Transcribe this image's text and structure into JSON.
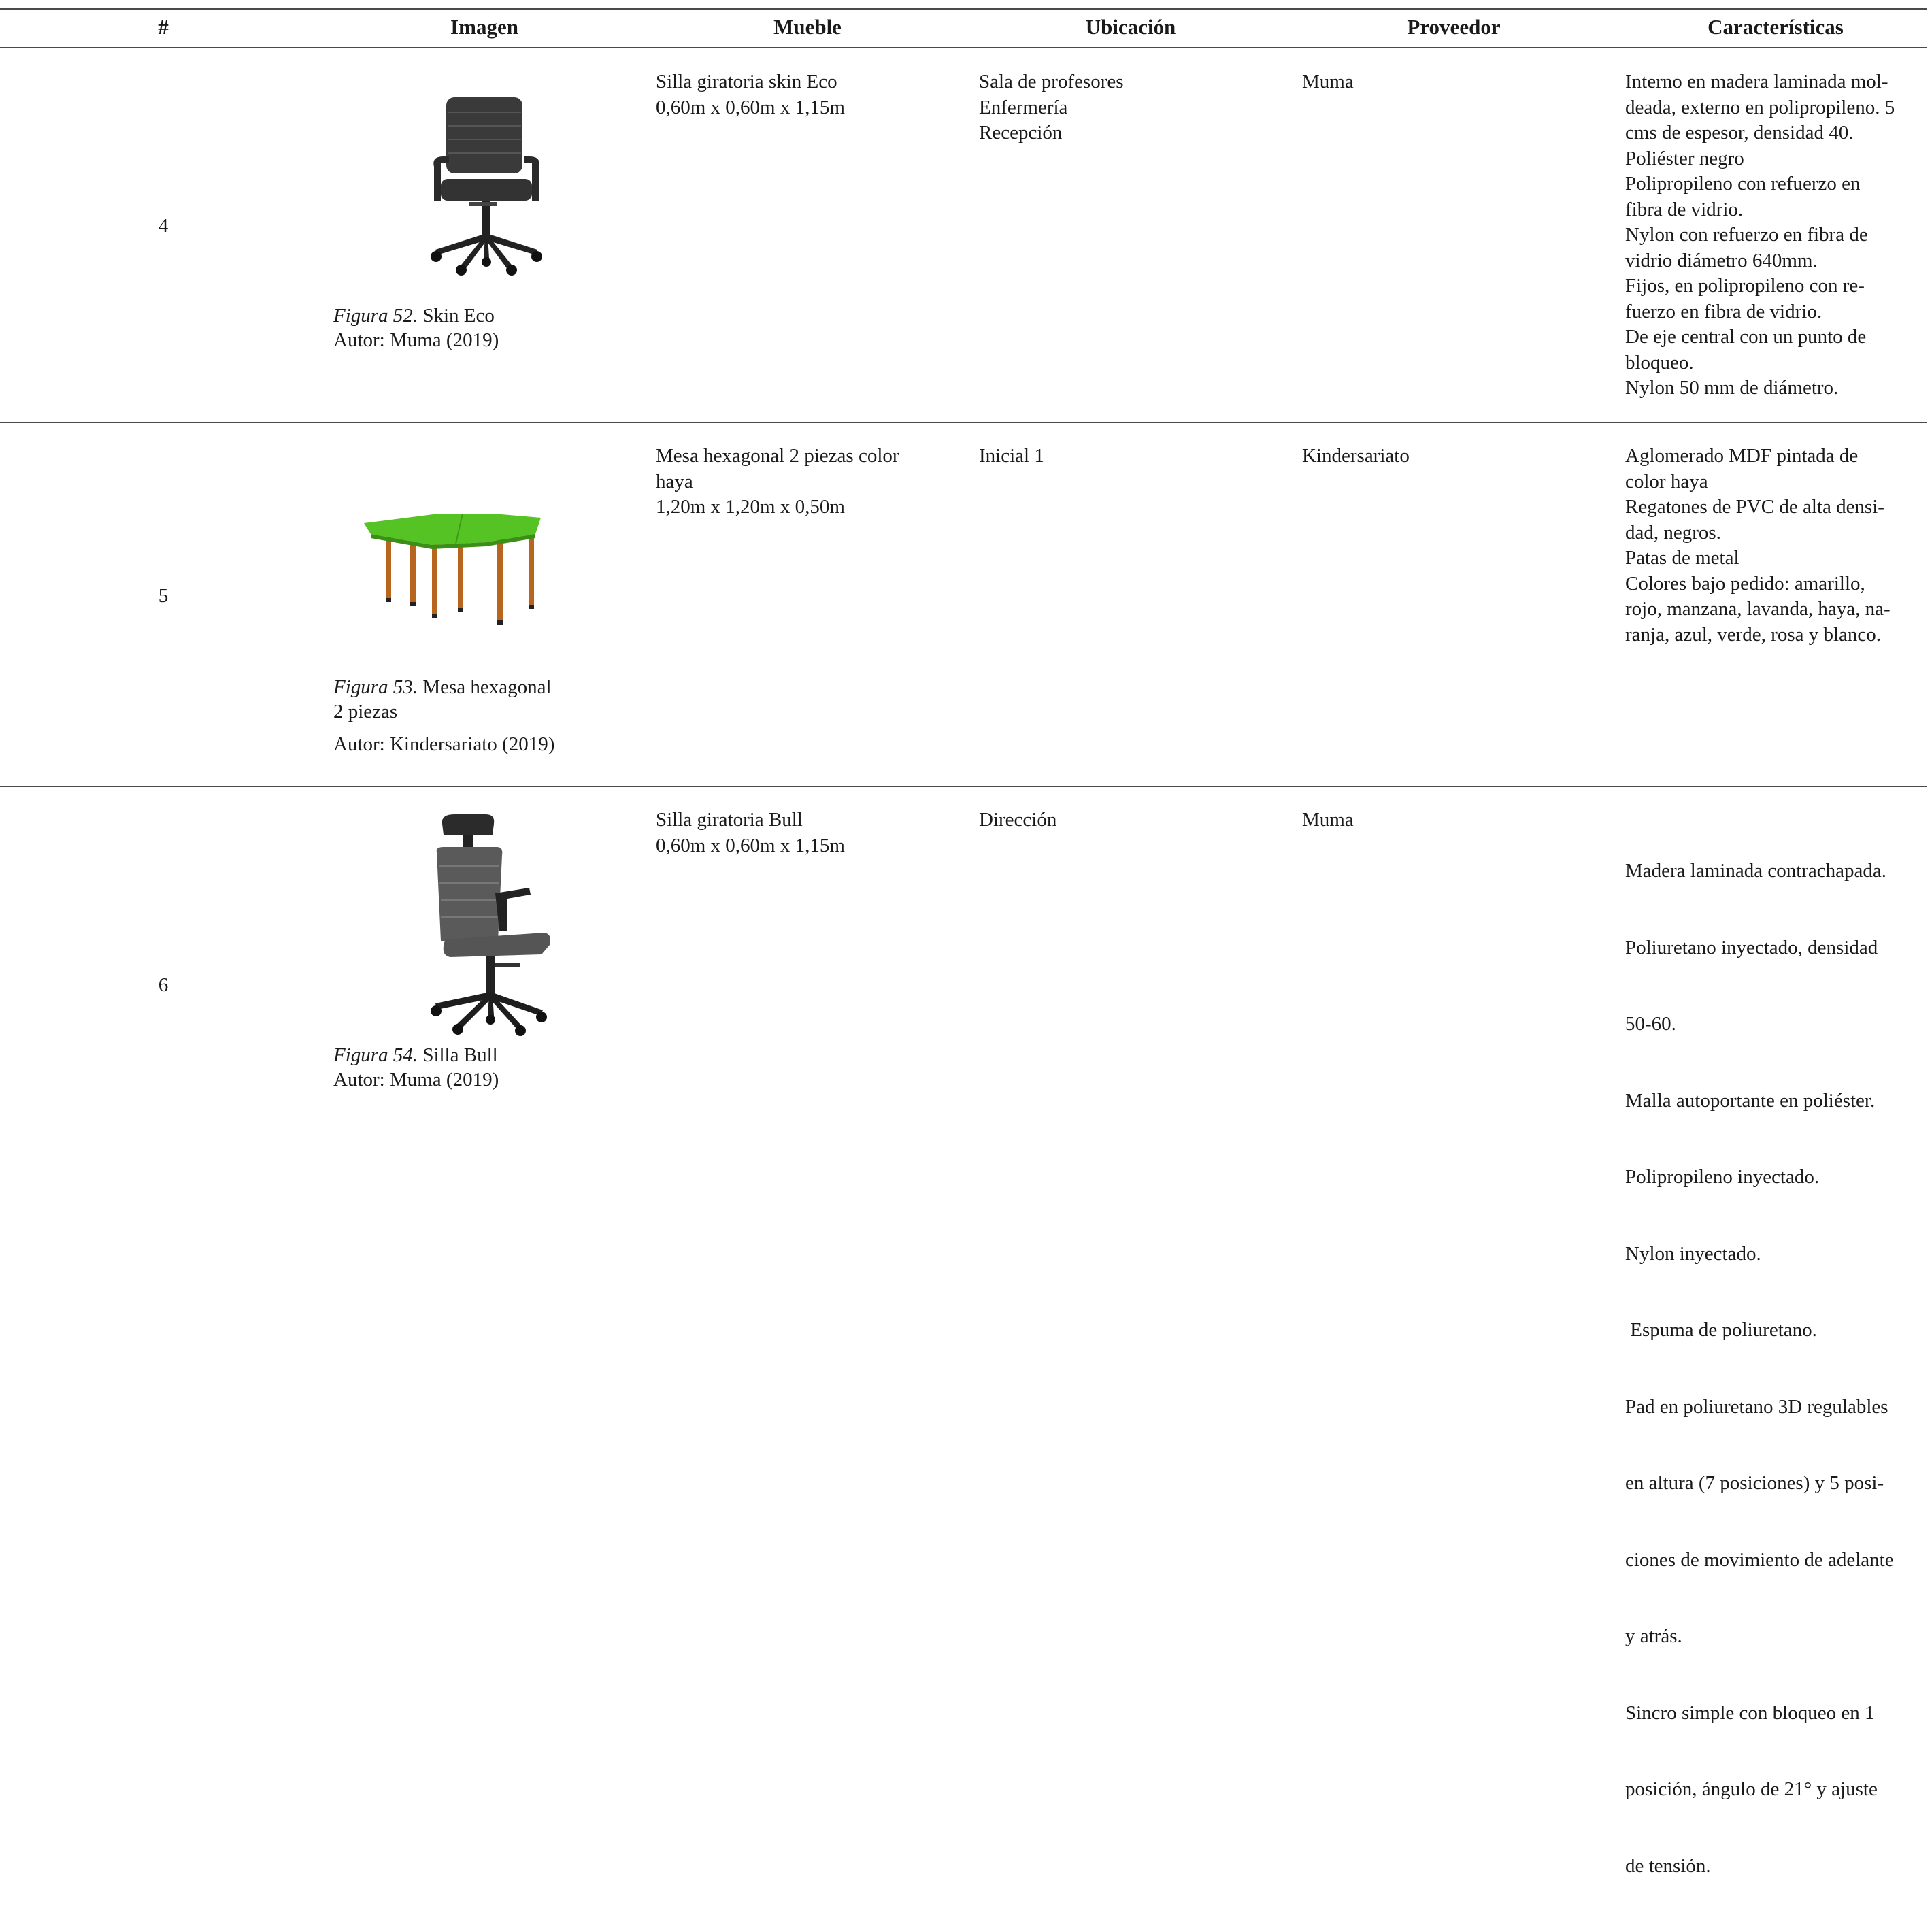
{
  "headers": [
    "#",
    "Imagen",
    "Mueble",
    "Ubicación",
    "Proveedor",
    "Características"
  ],
  "rows": [
    {
      "num": "4",
      "fig_label": "Figura 52.",
      "fig_title": "Skin Eco",
      "fig_title_2": "",
      "author": "Autor: Muma (2019)",
      "image_icon": "office-chair-mesh",
      "mueble": [
        "Silla giratoria skin Eco",
        "0,60m x 0,60m x 1,15m"
      ],
      "ubicacion": [
        "Sala de profesores",
        "Enfermería",
        "Recepción"
      ],
      "proveedor": "Muma",
      "caracteristicas": [
        "Interno en madera laminada mol-",
        "deada, externo en polipropileno. 5",
        "cms de espesor, densidad 40.",
        "Poliéster negro",
        "Polipropileno con refuerzo en",
        "fibra de vidrio.",
        "Nylon con refuerzo en fibra de",
        "vidrio diámetro 640mm.",
        "Fijos, en polipropileno con re-",
        "fuerzo en fibra de vidrio.",
        "De eje central con un punto de",
        "bloqueo.",
        "Nylon 50 mm de diámetro."
      ]
    },
    {
      "num": "5",
      "fig_label": "Figura 53.",
      "fig_title": "Mesa hexagonal",
      "fig_title_2": "2 piezas",
      "author": "Autor: Kindersariato (2019)",
      "image_icon": "hexagonal-table-green",
      "mueble": [
        "Mesa hexagonal 2 piezas color",
        "haya",
        "1,20m x 1,20m x 0,50m"
      ],
      "ubicacion": [
        "Inicial 1"
      ],
      "proveedor": "Kindersariato",
      "caracteristicas": [
        "Aglomerado MDF pintada de",
        "color haya",
        "Regatones de PVC de alta densi-",
        "dad, negros.",
        "Patas de metal",
        "Colores bajo pedido: amarillo,",
        "rojo, manzana, lavanda, haya, na-",
        "ranja, azul, verde, rosa y blanco."
      ]
    },
    {
      "num": "6",
      "fig_label": "Figura 54.",
      "fig_title": "Silla Bull",
      "fig_title_2": "",
      "author": "Autor: Muma (2019)",
      "image_icon": "office-chair-headrest",
      "mueble": [
        "Silla giratoria Bull",
        "0,60m x 0,60m x 1,15m"
      ],
      "ubicacion": [
        "Dirección"
      ],
      "proveedor": "Muma",
      "caracteristicas": [
        "Madera laminada contrachapada.",
        "Poliuretano inyectado, densidad",
        "50-60.",
        "Malla autoportante en poliéster.",
        "Polipropileno inyectado.",
        "Nylon inyectado.",
        " Espuma de poliuretano.",
        "Pad en poliuretano 3D regulables",
        "en altura (7 posiciones) y 5 posi-",
        "ciones de movimiento de adelante",
        "y atrás.",
        "Sincro simple con bloqueo en 1",
        "posición, ángulo de 21° y ajuste",
        "de tensión."
      ]
    }
  ]
}
